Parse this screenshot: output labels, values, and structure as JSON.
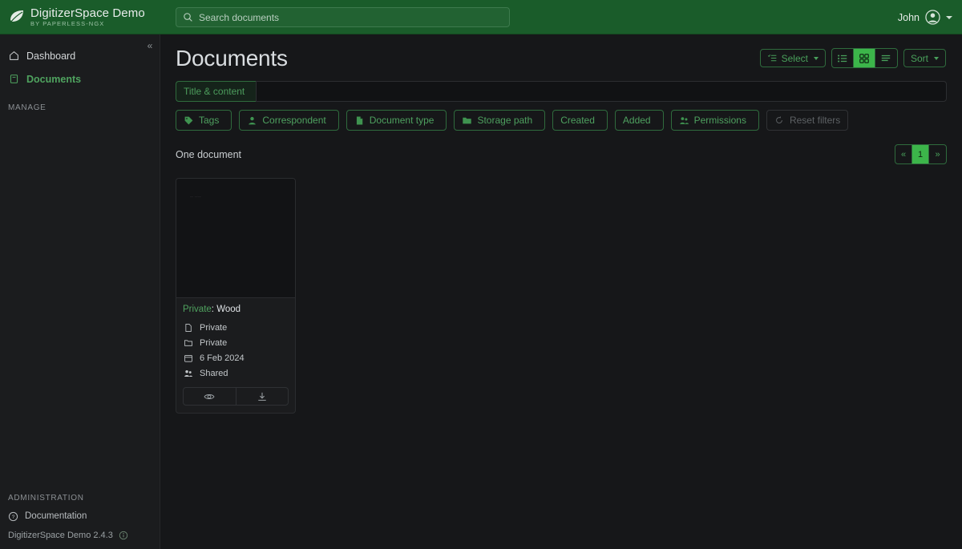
{
  "topbar": {
    "brand_title": "DigitizerSpace Demo",
    "brand_subtitle": "BY PAPERLESS-NGX",
    "brand_logo_icon": "leaf-icon",
    "search": {
      "placeholder": "Search documents",
      "value": "",
      "icon": "search-icon"
    },
    "user": {
      "name": "John",
      "avatar_icon": "user-avatar-icon",
      "caret_icon": "chevron-down-icon"
    },
    "background_color": "#1a5c2a"
  },
  "sidebar": {
    "collapse_icon": "«",
    "items": [
      {
        "label": "Dashboard",
        "icon": "home-icon",
        "active": false
      },
      {
        "label": "Documents",
        "icon": "document-icon",
        "active": true
      }
    ],
    "section_manage": "MANAGE",
    "section_administration": "ADMINISTRATION",
    "documentation": {
      "label": "Documentation",
      "icon": "question-circle-icon"
    },
    "version": {
      "label": "DigitizerSpace Demo 2.4.3",
      "icon": "info-circle-icon"
    }
  },
  "main": {
    "page_title": "Documents",
    "tools": {
      "select_label": "Select",
      "select_icon": "checklist-icon",
      "views": [
        {
          "name": "list-view",
          "icon": "list-icon",
          "active": false
        },
        {
          "name": "grid-view",
          "icon": "grid-icon",
          "active": true
        },
        {
          "name": "details-view",
          "icon": "details-icon",
          "active": false
        }
      ],
      "sort_label": "Sort"
    },
    "title_content_filter": {
      "dropdown_label": "Title & content",
      "input_value": "",
      "input_placeholder": ""
    },
    "filters": [
      {
        "label": "Tags",
        "icon": "tag-icon",
        "disabled": false
      },
      {
        "label": "Correspondent",
        "icon": "person-icon",
        "disabled": false
      },
      {
        "label": "Document type",
        "icon": "file-icon",
        "disabled": false
      },
      {
        "label": "Storage path",
        "icon": "folder-icon",
        "disabled": false
      },
      {
        "label": "Created",
        "icon": "",
        "disabled": false
      },
      {
        "label": "Added",
        "icon": "",
        "disabled": false
      },
      {
        "label": "Permissions",
        "icon": "people-icon",
        "disabled": false
      },
      {
        "label": "Reset filters",
        "icon": "reset-icon",
        "disabled": true
      }
    ],
    "results_text": "One document",
    "pagination": {
      "prev": "«",
      "pages": [
        "1"
      ],
      "next": "»",
      "current": "1"
    },
    "documents": [
      {
        "correspondent": "Private",
        "separator": ": ",
        "title": "Wood",
        "thumbnail_text": "— ——",
        "meta": [
          {
            "icon": "file-icon",
            "value": "Private"
          },
          {
            "icon": "folder-icon",
            "value": "Private"
          },
          {
            "icon": "calendar-icon",
            "value": "6 Feb 2024"
          },
          {
            "icon": "people-icon",
            "value": "Shared"
          }
        ],
        "actions": [
          {
            "name": "preview-button",
            "icon": "eye-icon"
          },
          {
            "name": "download-button",
            "icon": "download-icon"
          }
        ]
      }
    ]
  },
  "colors": {
    "brand_green": "#1a5c2a",
    "accent_green": "#3cb54a",
    "link_green": "#4fa35f",
    "page_bg": "#161719",
    "sidebar_bg": "#1b1c1e",
    "card_bg": "#1b1c1e"
  }
}
